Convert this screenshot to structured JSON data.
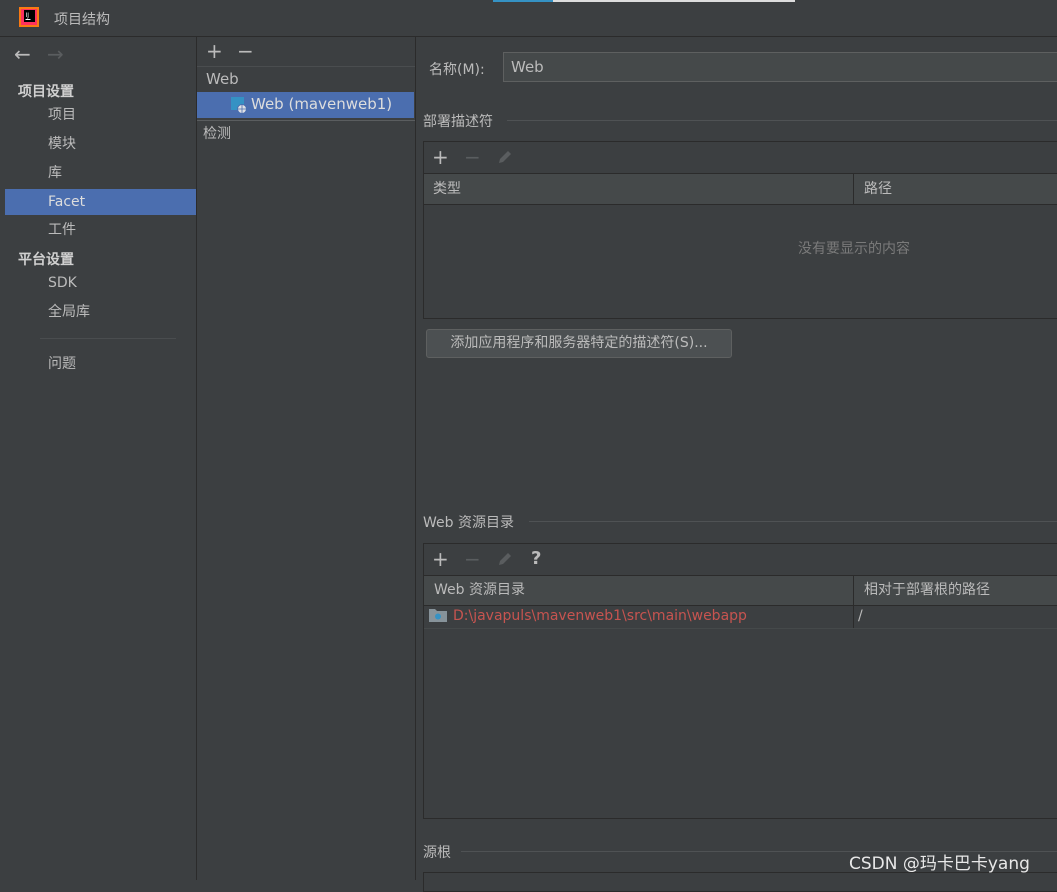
{
  "window": {
    "title": "项目结构"
  },
  "nav": {
    "back_icon": "arrow-left-icon",
    "forward_icon": "arrow-right-icon",
    "sections": [
      {
        "title": "项目设置",
        "items": [
          "项目",
          "模块",
          "库",
          "Facet",
          "工件"
        ]
      },
      {
        "title": "平台设置",
        "items": [
          "SDK",
          "全局库"
        ]
      }
    ],
    "problems": "问题",
    "selected": "Facet"
  },
  "tree": {
    "add": "+",
    "remove": "−",
    "group": "Web",
    "item": "Web (mavenweb1)",
    "detection": "检测"
  },
  "form": {
    "name_label": "名称(M):",
    "name_value": "Web"
  },
  "deploy": {
    "title": "部署描述符",
    "toolbar": {
      "add": "+",
      "remove": "−"
    },
    "columns": [
      "类型",
      "路径"
    ],
    "empty": "没有要显示的内容",
    "add_button": "添加应用程序和服务器特定的描述符(S)..."
  },
  "webres": {
    "title": "Web 资源目录",
    "toolbar": {
      "add": "+",
      "remove": "−",
      "help": "?"
    },
    "columns": [
      "Web 资源目录",
      "相对于部署根的路径"
    ],
    "rows": [
      {
        "path": "D:\\javapuls\\mavenweb1\\src\\main\\webapp",
        "relative": "/"
      }
    ]
  },
  "source_roots": {
    "title": "源根"
  },
  "watermark": "CSDN @玛卡巴卡yang",
  "colors": {
    "selection": "#4b6eaf",
    "background": "#3c3f41",
    "error_path": "#c75450"
  }
}
